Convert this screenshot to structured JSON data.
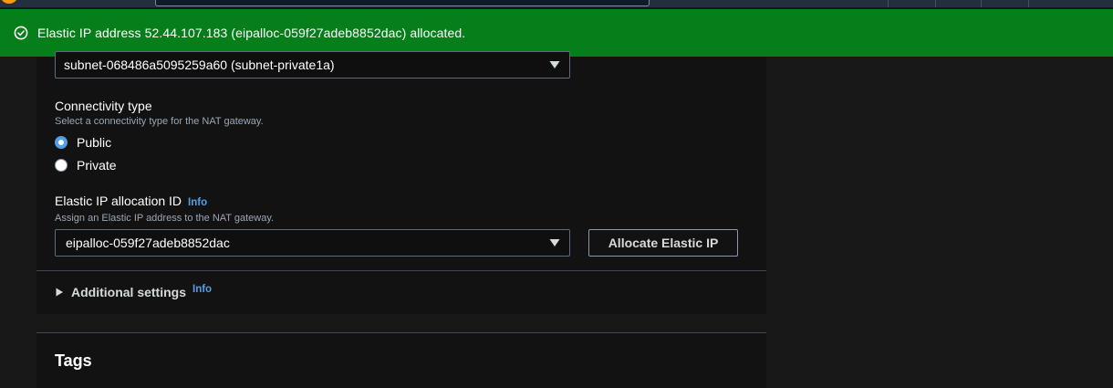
{
  "flash": {
    "message": "Elastic IP address 52.44.107.183 (eipalloc-059f27adeb8852dac) allocated.",
    "color": "#067f1a"
  },
  "subnet": {
    "selected": "subnet-068486a5095259a60 (subnet-private1a)"
  },
  "connectivity": {
    "label": "Connectivity type",
    "description": "Select a connectivity type for the NAT gateway.",
    "options": [
      {
        "label": "Public",
        "selected": true
      },
      {
        "label": "Private",
        "selected": false
      }
    ]
  },
  "elastic_ip": {
    "label": "Elastic IP allocation ID",
    "info": "Info",
    "description": "Assign an Elastic IP address to the NAT gateway.",
    "selected": "eipalloc-059f27adeb8852dac",
    "allocate_button": "Allocate Elastic IP"
  },
  "additional_settings": {
    "label": "Additional settings",
    "info": "Info"
  },
  "tags": {
    "title": "Tags"
  },
  "colors": {
    "accent": "#539fe5",
    "background": "#181818",
    "panel": "#121212"
  }
}
